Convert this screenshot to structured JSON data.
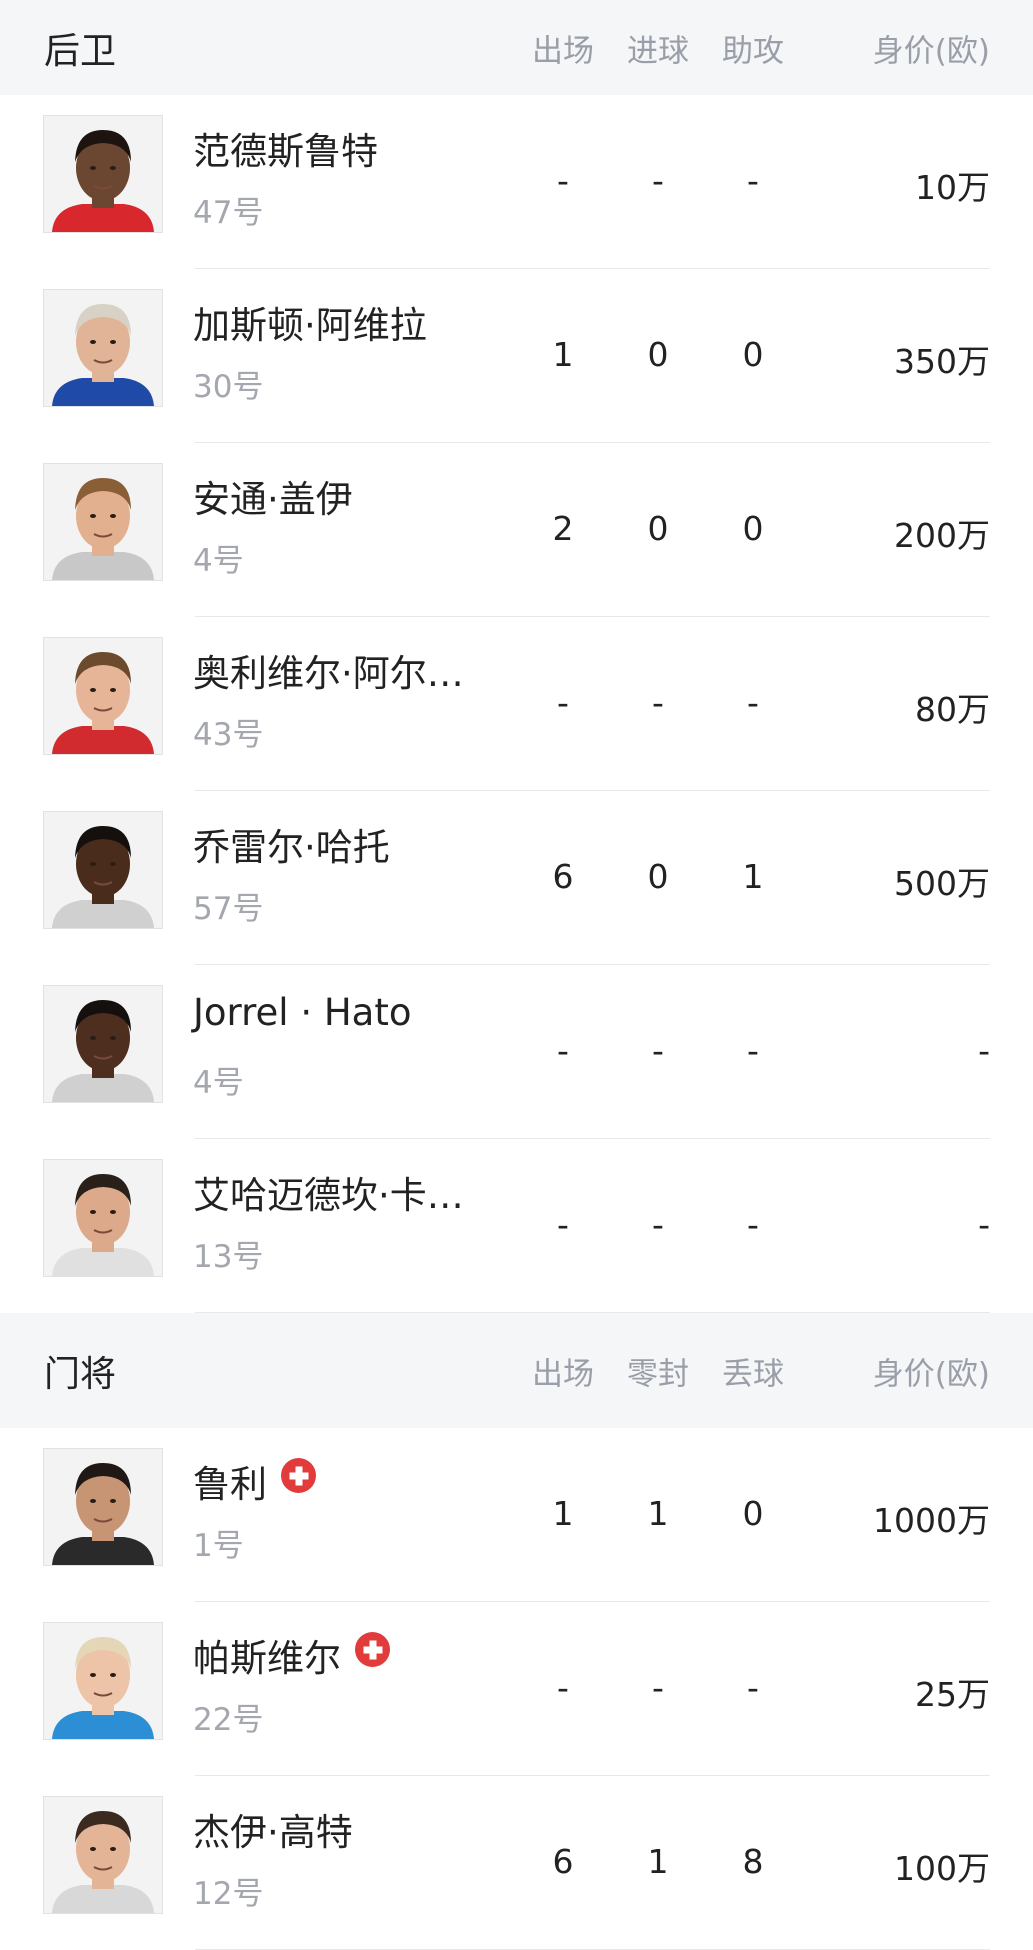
{
  "defenders": {
    "title": "后卫",
    "headers": [
      "出场",
      "进球",
      "助攻",
      "身价(欧)"
    ],
    "players": [
      {
        "name": "范德斯鲁特",
        "number": "47号",
        "apps": "-",
        "goals": "-",
        "assists": "-",
        "value": "10万",
        "skin": "#6b4630",
        "hair": "#1d1410",
        "shirt": "#d9272e"
      },
      {
        "name": "加斯顿·阿维拉",
        "number": "30号",
        "apps": "1",
        "goals": "0",
        "assists": "0",
        "value": "350万",
        "skin": "#e2b497",
        "hair": "#d8d2c6",
        "shirt": "#1f4aa8"
      },
      {
        "name": "安通·盖伊",
        "number": "4号",
        "apps": "2",
        "goals": "0",
        "assists": "0",
        "value": "200万",
        "skin": "#e3b08f",
        "hair": "#8a5f38",
        "shirt": "#c8c8c8"
      },
      {
        "name": "奥利维尔·阿尔…",
        "number": "43号",
        "apps": "-",
        "goals": "-",
        "assists": "-",
        "value": "80万",
        "skin": "#e6b597",
        "hair": "#6b4a2e",
        "shirt": "#d12a2f"
      },
      {
        "name": "乔雷尔·哈托",
        "number": "57号",
        "apps": "6",
        "goals": "0",
        "assists": "1",
        "value": "500万",
        "skin": "#4a2c1d",
        "hair": "#15100d",
        "shirt": "#d0d0d0"
      },
      {
        "name": "Jorrel · Hato",
        "number": "4号",
        "apps": "-",
        "goals": "-",
        "assists": "-",
        "value": "-",
        "skin": "#4d2e1f",
        "hair": "#15100d",
        "shirt": "#d0d0d0"
      },
      {
        "name": "艾哈迈德坎·卡…",
        "number": "13号",
        "apps": "-",
        "goals": "-",
        "assists": "-",
        "value": "-",
        "skin": "#dca98a",
        "hair": "#2a201a",
        "shirt": "#e0e0e0"
      }
    ]
  },
  "goalkeepers": {
    "title": "门将",
    "headers": [
      "出场",
      "零封",
      "丢球",
      "身价(欧)"
    ],
    "players": [
      {
        "name": "鲁利",
        "number": "1号",
        "apps": "1",
        "goals": "1",
        "assists": "0",
        "value": "1000万",
        "skin": "#c79474",
        "hair": "#1f1814",
        "shirt": "#2a2a2a",
        "flag": "swiss-flag-icon"
      },
      {
        "name": "帕斯维尔",
        "number": "22号",
        "apps": "-",
        "goals": "-",
        "assists": "-",
        "value": "25万",
        "skin": "#edc4a7",
        "hair": "#e4d7b8",
        "shirt": "#2c8fd6",
        "flag": "swiss-flag-icon"
      },
      {
        "name": "杰伊·高特",
        "number": "12号",
        "apps": "6",
        "goals": "1",
        "assists": "8",
        "value": "100万",
        "skin": "#e4b496",
        "hair": "#3a2a20",
        "shirt": "#d8d8d8"
      }
    ]
  }
}
